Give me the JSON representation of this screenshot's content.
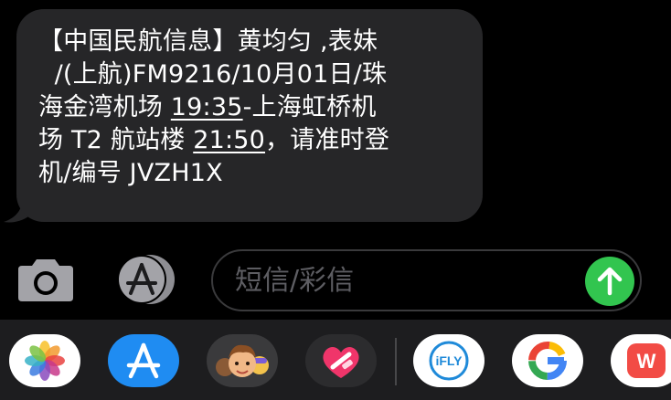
{
  "message": {
    "lines": [
      "【中国民航信息】黄均匀 ,表妹",
      "  /(上航)FM9216/10月01日/珠",
      "海金湾机场 ",
      "19:35",
      "-上海虹桥机",
      "场 T2 航站楼 ",
      "21:50",
      "，请准时登",
      "机/编号 JVZH1X"
    ]
  },
  "composer": {
    "placeholder": "短信/彩信",
    "camera_icon": "camera-icon",
    "apps_icon": "app-store-icon",
    "send_icon": "arrow-up-icon"
  },
  "drawer": {
    "apps": [
      {
        "name": "photos",
        "icon": "photos-icon"
      },
      {
        "name": "app-store",
        "icon": "app-store-icon"
      },
      {
        "name": "memoji",
        "icon": "memoji-icon"
      },
      {
        "name": "digital-touch",
        "icon": "heart-icon"
      },
      {
        "name": "ifly",
        "icon": "ifly-icon",
        "label": "iFLY"
      },
      {
        "name": "google",
        "icon": "google-icon",
        "label": "G"
      },
      {
        "name": "wps",
        "icon": "wps-icon",
        "label": "W"
      }
    ]
  },
  "colors": {
    "bubble": "#262628",
    "send": "#32c54f",
    "drawer": "#1d1d1f",
    "placeholder": "#5d5d62"
  }
}
